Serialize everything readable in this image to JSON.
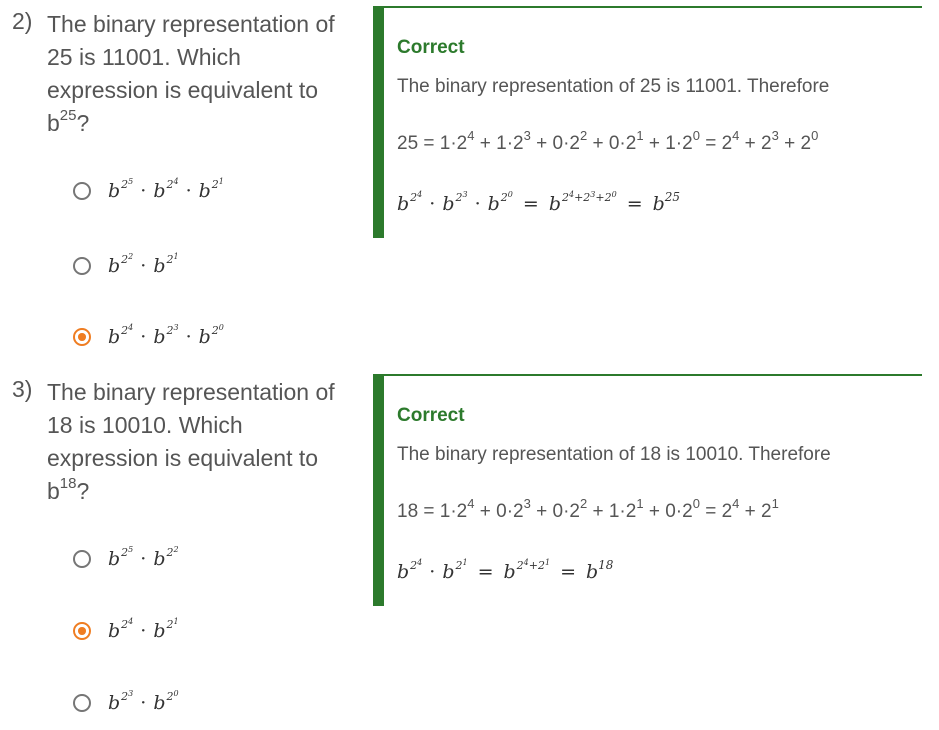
{
  "questions": [
    {
      "number": "2)",
      "text_parts": [
        "The binary representation of 25 is 11001. Which expression is equivalent to b",
        "25",
        "?"
      ],
      "options": [
        {
          "base": "b",
          "exps": [
            "2",
            "5",
            "2",
            "4",
            "2",
            "1"
          ],
          "selected": false
        },
        {
          "base": "b",
          "exps": [
            "2",
            "2",
            "2",
            "1"
          ],
          "selected": false
        },
        {
          "base": "b",
          "exps": [
            "2",
            "4",
            "2",
            "3",
            "2",
            "0"
          ],
          "selected": true
        }
      ],
      "feedback": {
        "title": "Correct",
        "explanation": "The binary representation of 25 is 11001. Therefore",
        "equation_parts": [
          "25 = 1·2",
          "4",
          " + 1·2",
          "3",
          " + 0·2",
          "2",
          " + 0·2",
          "1",
          " + 1·2",
          "0",
          " = 2",
          "4",
          " + 2",
          "3",
          " + 2",
          "0"
        ],
        "math_result": "25"
      }
    },
    {
      "number": "3)",
      "text_parts": [
        "The binary representation of 18 is 10010. Which expression is equivalent to b",
        "18",
        "?"
      ],
      "options": [
        {
          "base": "b",
          "exps": [
            "2",
            "5",
            "2",
            "2"
          ],
          "selected": false
        },
        {
          "base": "b",
          "exps": [
            "2",
            "4",
            "2",
            "1"
          ],
          "selected": true
        },
        {
          "base": "b",
          "exps": [
            "2",
            "3",
            "2",
            "0"
          ],
          "selected": false
        }
      ],
      "feedback": {
        "title": "Correct",
        "explanation": "The binary representation of 18 is 10010. Therefore",
        "equation_parts": [
          "18 = 1·2",
          "4",
          " + 0·2",
          "3",
          " + 0·2",
          "2",
          " + 1·2",
          "1",
          " + 0·2",
          "0",
          " = 2",
          "4",
          " + 2",
          "1"
        ],
        "math_result": "18"
      }
    }
  ],
  "colors": {
    "accent_selected": "#ef7d22",
    "correct_green": "#2c7a2c",
    "text_gray": "#555555"
  },
  "icons": {
    "radio_unselected": "radio-unselected-icon",
    "radio_selected": "radio-selected-icon"
  }
}
